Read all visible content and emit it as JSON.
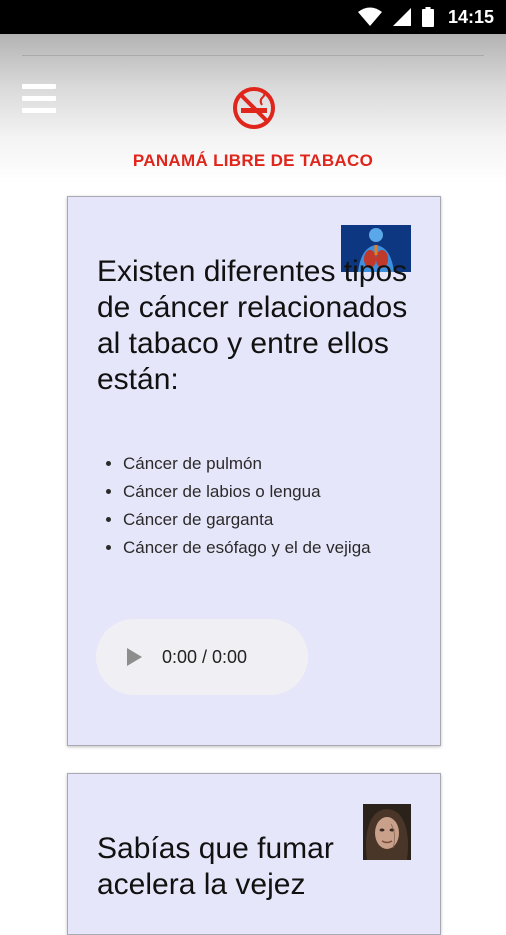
{
  "status_bar": {
    "time": "14:15"
  },
  "header": {
    "title": "PANAMÁ LIBRE DE TABACO",
    "brand_color": "#e0251b",
    "logo_icon": "no-smoking-icon",
    "menu_icon": "hamburger-menu-icon"
  },
  "cards": [
    {
      "heading": "Existen diferentes tipos de cáncer relacionados al tabaco y entre ellos están:",
      "thumbnail_icon": "lungs-anatomy-image",
      "items": [
        "Cáncer de pulmón",
        "Cáncer de labios o lengua",
        "Cáncer de garganta",
        "Cáncer de esófago y el de vejiga"
      ],
      "audio": {
        "time": "0:00 / 0:00"
      }
    },
    {
      "heading": "Sabías que fumar acelera la vejez",
      "thumbnail_icon": "aged-face-image"
    }
  ],
  "colors": {
    "card_background": "#e6e6fa"
  }
}
